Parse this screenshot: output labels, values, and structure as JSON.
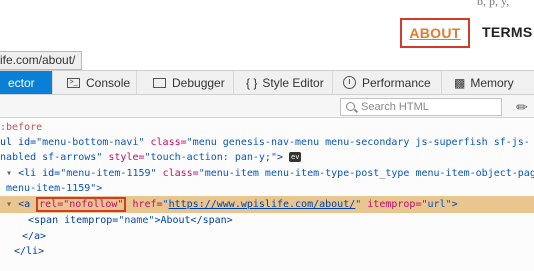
{
  "site": {
    "clip_text": "b, p, y,",
    "nav": {
      "about": "ABOUT",
      "terms": "TERMS C"
    }
  },
  "url_tooltip": "ife.com/about/",
  "devtools": {
    "tabs": [
      {
        "label": "ector",
        "active": true,
        "icon": "inspector-icon"
      },
      {
        "label": "Console",
        "active": false,
        "icon": "console-icon"
      },
      {
        "label": "Debugger",
        "active": false,
        "icon": "debugger-icon"
      },
      {
        "label": "Style Editor",
        "active": false,
        "icon": "style-editor-icon"
      },
      {
        "label": "Performance",
        "active": false,
        "icon": "performance-icon"
      },
      {
        "label": "Memory",
        "active": false,
        "icon": "memory-icon"
      }
    ],
    "search_placeholder": "Search HTML",
    "markup": {
      "l1": ":before",
      "l2_a": "ul id=",
      "l2_b": "\"menu-bottom-navi\"",
      "l2_c": " class=",
      "l2_d": "\"menu genesis-nav-menu menu-secondary js-superfish sf-js-",
      "l3_a": "nabled sf-arrows\"",
      "l3_b": " style=",
      "l3_c": "\"touch-action: pan-y;\"",
      "l3_d": ">",
      "l3_badge": "ev",
      "l4_a": "<li id=",
      "l4_b": "\"menu-item-1159\"",
      "l4_c": " class=",
      "l4_d": "\"menu-item menu-item-type-post_type menu-item-object-page",
      "l5": "menu-item-1159\">",
      "l6_tag": "<a",
      "l6_rel": "rel=\"nofollow\"",
      "l6_href_attr": " href=",
      "l6_href_q1": "\"",
      "l6_href": "https://www.wpislife.com/about/",
      "l6_href_q2": "\"",
      "l6_itemprop": " itemprop=",
      "l6_itemprop_val": "\"url\"",
      "l6_end": ">",
      "l7_a": "<span itemprop=",
      "l7_b": "\"name\"",
      "l7_c": ">About</span>",
      "l8": "</a>",
      "l9": "</li>"
    }
  }
}
